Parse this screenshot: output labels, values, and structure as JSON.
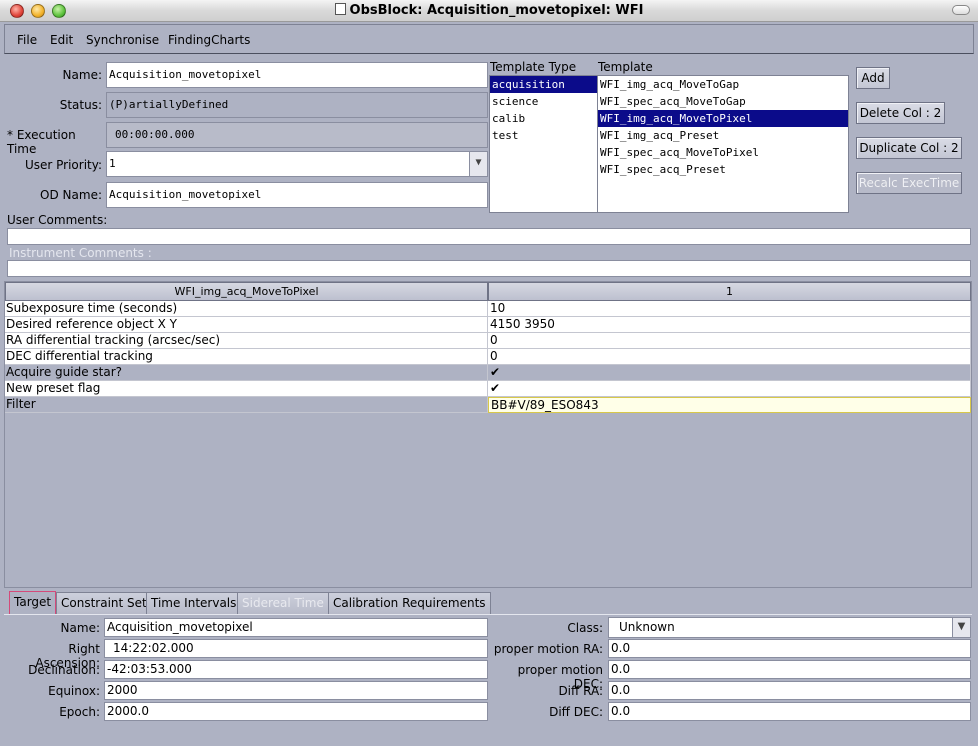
{
  "window": {
    "title": "ObsBlock: Acquisition_movetopixel: WFI"
  },
  "menu": [
    "File",
    "Edit",
    "Synchronise",
    "FindingCharts"
  ],
  "form": {
    "name_label": "Name:",
    "name_value": "Acquisition_movetopixel",
    "status_label": "Status:",
    "status_value": "(P)artiallyDefined",
    "exec_label": "* Execution Time",
    "exec_value": "00:00:00.000",
    "priority_label": "User Priority:",
    "priority_value": "1",
    "od_label": "OD Name:",
    "od_value": "Acquisition_movetopixel"
  },
  "template_type": {
    "header": "Template Type",
    "items": [
      "acquisition",
      "science",
      "calib",
      "test"
    ],
    "selected": "acquisition"
  },
  "template": {
    "header": "Template",
    "items": [
      "WFI_img_acq_MoveToGap",
      "WFI_spec_acq_MoveToGap",
      "WFI_img_acq_MoveToPixel",
      "WFI_img_acq_Preset",
      "WFI_spec_acq_MoveToPixel",
      "WFI_spec_acq_Preset"
    ],
    "selected": "WFI_img_acq_MoveToPixel"
  },
  "buttons": {
    "add": "Add",
    "delete_col": "Delete Col : 2",
    "duplicate_col": "Duplicate Col : 2",
    "recalc": "Recalc ExecTime"
  },
  "comments": {
    "user_label": "User Comments:",
    "user_value": "",
    "instrument_label": "Instrument Comments :",
    "instrument_value": ""
  },
  "table": {
    "col_header": "WFI_img_acq_MoveToPixel",
    "col_num": "1",
    "rows": [
      {
        "param": "Subexposure time (seconds)",
        "value": "10",
        "check": false
      },
      {
        "param": "Desired reference object X Y",
        "value": "4150 3950",
        "check": false
      },
      {
        "param": "RA differential tracking (arcsec/sec)",
        "value": "0",
        "check": false
      },
      {
        "param": "DEC differential tracking",
        "value": "0",
        "check": false
      },
      {
        "param": "Acquire guide star?",
        "value": "✔",
        "check": true
      },
      {
        "param": "New preset flag",
        "value": "✔",
        "check": true
      },
      {
        "param": "Filter",
        "value": "BB#V/89_ESO843",
        "check": false
      }
    ]
  },
  "tabs": [
    "Target",
    "Constraint Set",
    "Time Intervals",
    "Sidereal Time",
    "Calibration Requirements"
  ],
  "target": {
    "name_label": "Name:",
    "name_value": "Acquisition_movetopixel",
    "ra_label": "Right Ascension:",
    "ra_value": "14:22:02.000",
    "dec_label": "Declination:",
    "dec_value": "-42:03:53.000",
    "equinox_label": "Equinox:",
    "equinox_value": "2000",
    "epoch_label": "Epoch:",
    "epoch_value": "2000.0",
    "class_label": "Class:",
    "class_value": "Unknown",
    "pm_ra_label": "proper motion RA:",
    "pm_ra_value": "0.0",
    "pm_dec_label": "proper motion DEC:",
    "pm_dec_value": "0.0",
    "diff_ra_label": "Diff RA:",
    "diff_ra_value": "0.0",
    "diff_dec_label": "Diff DEC:",
    "diff_dec_value": "0.0"
  }
}
